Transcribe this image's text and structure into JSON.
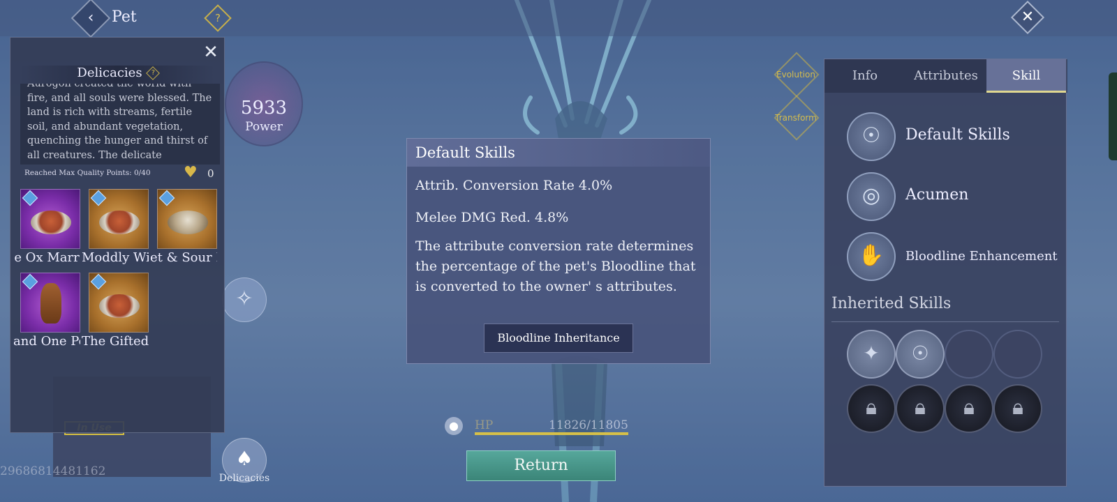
{
  "topbar": {
    "back_icon": "‹",
    "title": "Pet",
    "help_label": "?",
    "close_icon": "✕"
  },
  "pet_id": "29686814481162",
  "in_use_label": "In Use",
  "power": {
    "value": "5933",
    "label": "Power"
  },
  "evolution_label": "Evolution",
  "transform_label": "Transform",
  "delicacies_panel": {
    "close_icon": "✕",
    "title": "Delicacies",
    "help_label": "?",
    "description": "Aurogon created the world with fire, and all souls were blessed. The land is rich with streams, fertile soil, and abundant vegetation, quenching the hunger and thirst of all creatures. The delicate fragrance of nature and",
    "quality_points": "Reached Max Quality Points: 0/40",
    "heart_count": "0",
    "items": [
      {
        "label": "e Ox Marr",
        "rarity": "purple"
      },
      {
        "label": "Moddly Wi",
        "rarity": "orange"
      },
      {
        "label": "et & Sour Ic",
        "rarity": "orange"
      },
      {
        "label": "and One Po",
        "rarity": "purple"
      },
      {
        "label": "The Gifted",
        "rarity": "orange"
      }
    ]
  },
  "delicacies_button_label": "Delicacies",
  "popup": {
    "title": "Default Skills",
    "line1": "Attrib. Conversion Rate 4.0%",
    "line2": "Melee DMG Red. 4.8%",
    "body": "The attribute conversion rate determines the percentage of the pet's Bloodline that is converted to the owner' s attributes.",
    "button_label": "Bloodline Inheritance"
  },
  "hp": {
    "label": "HP",
    "value": "11826/11805",
    "fill_percent": 100
  },
  "return_label": "Return",
  "right_panel": {
    "tabs": [
      "Info",
      "Attributes",
      "Skill"
    ],
    "active_tab": "Skill",
    "skills": [
      "Default Skills",
      "Acumen",
      "Bloodline Enhancement"
    ],
    "inherited_title": "Inherited Skills"
  },
  "colors": {
    "accent_gold": "#d6bd4c",
    "return_green": "#4a9a8c",
    "panel_bg": "#3a4260"
  }
}
